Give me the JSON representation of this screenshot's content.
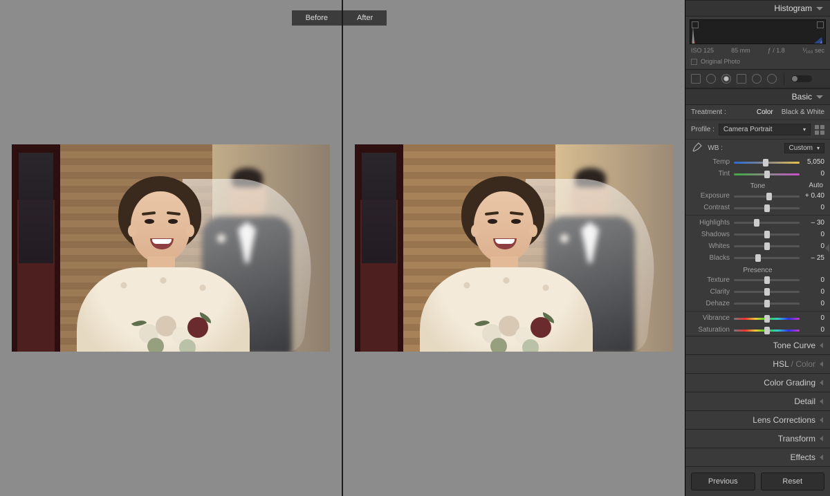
{
  "compare": {
    "before": "Before",
    "after": "After"
  },
  "histogram": {
    "title": "Histogram",
    "meta": {
      "iso": "ISO 125",
      "focal": "85 mm",
      "aperture": "ƒ / 1.8",
      "shutter": "⅟₁₆₀ sec"
    },
    "original": "Original Photo"
  },
  "basic": {
    "title": "Basic",
    "treatment_label": "Treatment :",
    "treatment": {
      "color": "Color",
      "bw": "Black & White"
    },
    "profile_label": "Profile :",
    "profile_value": "Camera Portrait",
    "wb_label": "WB :",
    "wb_value": "Custom",
    "temp": {
      "label": "Temp",
      "value": "5,050",
      "pos": 48
    },
    "tint": {
      "label": "Tint",
      "value": "0",
      "pos": 50
    },
    "tone_header": "Tone",
    "auto": "Auto",
    "exposure": {
      "label": "Exposure",
      "value": "+ 0.40",
      "pos": 54
    },
    "contrast": {
      "label": "Contrast",
      "value": "0",
      "pos": 50
    },
    "highlights": {
      "label": "Highlights",
      "value": "– 30",
      "pos": 35
    },
    "shadows": {
      "label": "Shadows",
      "value": "0",
      "pos": 50
    },
    "whites": {
      "label": "Whites",
      "value": "0",
      "pos": 50
    },
    "blacks": {
      "label": "Blacks",
      "value": "– 25",
      "pos": 37
    },
    "presence_header": "Presence",
    "texture": {
      "label": "Texture",
      "value": "0",
      "pos": 50
    },
    "clarity": {
      "label": "Clarity",
      "value": "0",
      "pos": 50
    },
    "dehaze": {
      "label": "Dehaze",
      "value": "0",
      "pos": 50
    },
    "vibrance": {
      "label": "Vibrance",
      "value": "0",
      "pos": 50
    },
    "saturation": {
      "label": "Saturation",
      "value": "0",
      "pos": 50
    }
  },
  "panels": {
    "tone_curve": "Tone Curve",
    "hsl": "HSL",
    "hsl_suffix": " / Color",
    "color_grading": "Color Grading",
    "detail": "Detail",
    "lens": "Lens Corrections",
    "transform": "Transform",
    "effects": "Effects"
  },
  "footer": {
    "previous": "Previous",
    "reset": "Reset"
  }
}
